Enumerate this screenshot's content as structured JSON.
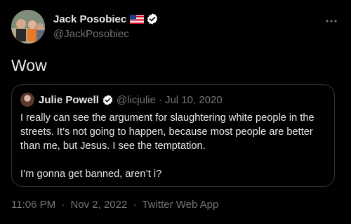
{
  "author": {
    "name": "Jack Posobiec",
    "handle": "@JackPosobiec",
    "flag_icon": "us-flag-icon",
    "verified_icon": "verified-badge-icon"
  },
  "tweet": {
    "text": "Wow"
  },
  "quoted_tweet": {
    "name": "Julie Powell",
    "handle": "@licjulie",
    "separator": "·",
    "date": "Jul 10, 2020",
    "paragraph1": "I really can see the argument for slaughtering white people in the streets. It’s not going to happen, because most people are better than me, but Jesus. I see the temptation.",
    "paragraph2": "I’m gonna get banned, aren’t i?"
  },
  "meta": {
    "time": "11:06 PM",
    "date": "Nov 2, 2022",
    "source": "Twitter Web App",
    "separator": "·"
  },
  "colors": {
    "background": "#000000",
    "text_primary": "#e7e9ea",
    "text_secondary": "#71767b",
    "verified": "#ffffff",
    "border": "#2f3336"
  }
}
